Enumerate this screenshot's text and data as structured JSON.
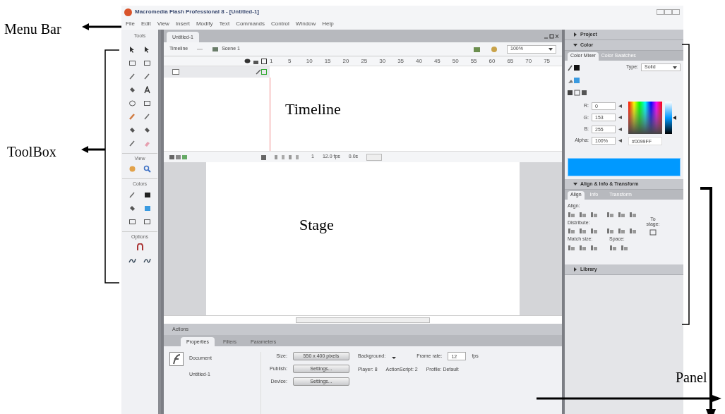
{
  "window": {
    "title": "Macromedia Flash Professional 8 - [Untitled-1]"
  },
  "menu": [
    "File",
    "Edit",
    "View",
    "Insert",
    "Modify",
    "Text",
    "Commands",
    "Control",
    "Window",
    "Help"
  ],
  "tools": {
    "title": "Tools",
    "sections": [
      "View",
      "Colors",
      "Options"
    ]
  },
  "document": {
    "tab": "Untitled-1",
    "timeline_button": "Timeline",
    "scene": "Scene 1",
    "zoom": "100%",
    "frame_numbers": [
      "1",
      "5",
      "10",
      "15",
      "20",
      "25",
      "30",
      "35",
      "40",
      "45",
      "50",
      "55",
      "60",
      "65",
      "70",
      "75"
    ],
    "current_frame": "1",
    "frame_rate": "12.0 fps",
    "elapsed": "0.0s"
  },
  "panels": {
    "project": "Project",
    "color": {
      "title": "Color",
      "tabs": [
        {
          "label": "Color Mixer",
          "selected": true
        },
        {
          "label": "Color Swatches",
          "selected": false
        }
      ],
      "type_label": "Type:",
      "type": "Solid",
      "fields": [
        {
          "label": "R:",
          "value": "0"
        },
        {
          "label": "G:",
          "value": "153"
        },
        {
          "label": "B:",
          "value": "255"
        },
        {
          "label": "Alpha:",
          "value": "100%"
        }
      ],
      "hex": "#0099FF",
      "brightness": {
        "level": 0.5
      }
    },
    "align": {
      "title": "Align & Info & Transform",
      "tabs": [
        {
          "label": "Align",
          "selected": true
        },
        {
          "label": "Info",
          "selected": false
        },
        {
          "label": "Transform",
          "selected": false
        }
      ],
      "align_label": "Align:",
      "distribute_label": "Distribute:",
      "match_label": "Match size:",
      "space_label": "Space:",
      "to_stage": "To stage:"
    },
    "library": "Library"
  },
  "actions": "Actions",
  "properties": {
    "tabs": [
      {
        "label": "Properties",
        "selected": true
      },
      {
        "label": "Filters",
        "selected": false
      },
      {
        "label": "Parameters",
        "selected": false
      }
    ],
    "doc_kind": "Document",
    "doc_name": "Untitled-1",
    "size_label": "Size:",
    "size": "550 x 400 pixels",
    "publish_label": "Publish:",
    "publish": "Settings...",
    "device_label": "Device:",
    "device": "Settings...",
    "background_label": "Background:",
    "frame_rate_label": "Frame rate:",
    "frame_rate": "12",
    "fps": "fps",
    "player": "Player: 8",
    "actionscript": "ActionScript: 2",
    "profile": "Profile: Default"
  },
  "annotations": [
    {
      "text": "Menu Bar",
      "kind": "menu"
    },
    {
      "text": "ToolBox",
      "kind": "toolbox"
    },
    {
      "text": "Timeline",
      "kind": "plain"
    },
    {
      "text": "Stage",
      "kind": "plain"
    },
    {
      "text": "Panel",
      "kind": "panel"
    }
  ]
}
